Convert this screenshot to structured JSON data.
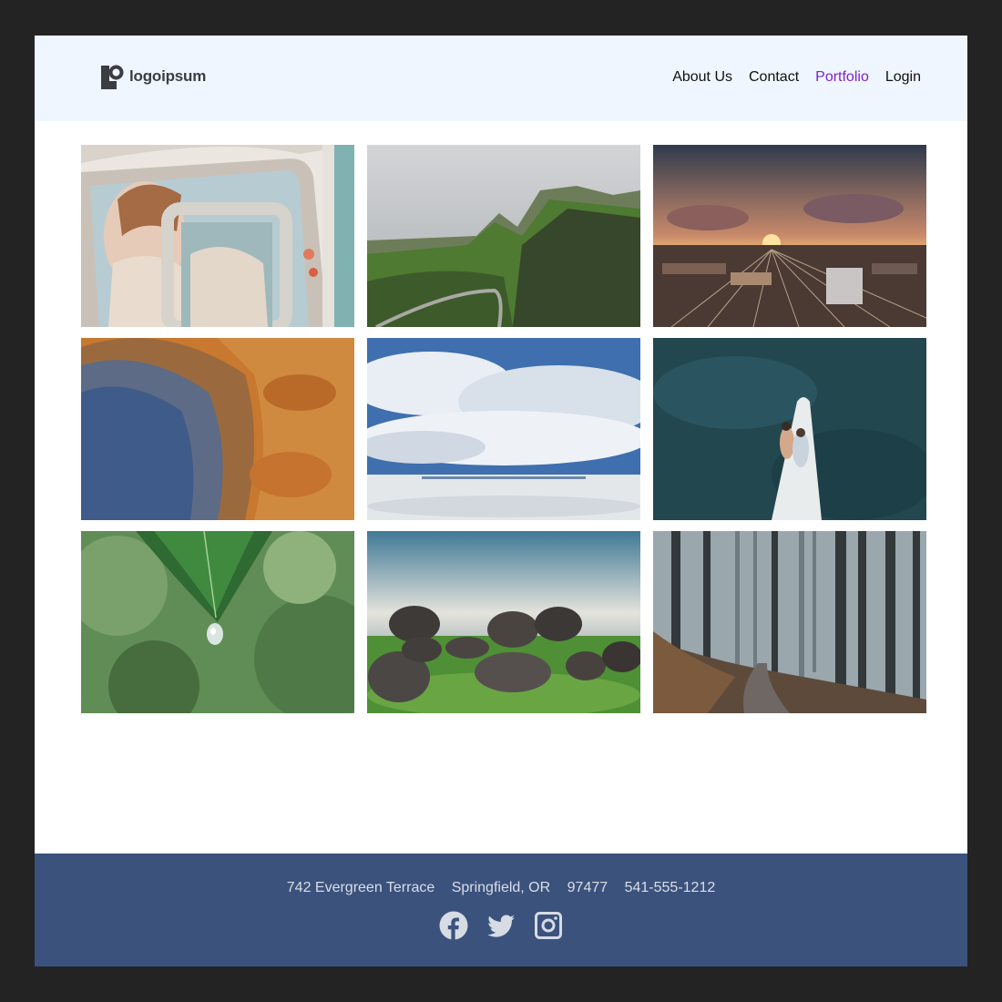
{
  "header": {
    "logo_text": "logoipsum",
    "nav": [
      {
        "label": "About Us",
        "active": false
      },
      {
        "label": "Contact",
        "active": false
      },
      {
        "label": "Portfolio",
        "active": true
      },
      {
        "label": "Login",
        "active": false
      }
    ]
  },
  "gallery": {
    "images": [
      {
        "subject": "bride-in-vintage-car"
      },
      {
        "subject": "green-mountain-valley-road"
      },
      {
        "subject": "railway-yard-sunset"
      },
      {
        "subject": "aerial-crater-desert"
      },
      {
        "subject": "cloud-reflection-salt-flat"
      },
      {
        "subject": "couple-on-boat-aerial"
      },
      {
        "subject": "leaf-water-drop"
      },
      {
        "subject": "boulders-on-grass"
      },
      {
        "subject": "misty-forest-path"
      }
    ]
  },
  "footer": {
    "street": "742 Evergreen Terrace",
    "city": "Springfield, OR",
    "zip": "97477",
    "phone": "541-555-1212",
    "social": [
      "facebook-icon",
      "twitter-icon",
      "instagram-icon"
    ]
  },
  "colors": {
    "background": "#232323",
    "header_bg": "#eff6ff",
    "nav_active": "#7e22ce",
    "footer_bg": "#3b527c",
    "footer_text": "#d9dee8"
  }
}
